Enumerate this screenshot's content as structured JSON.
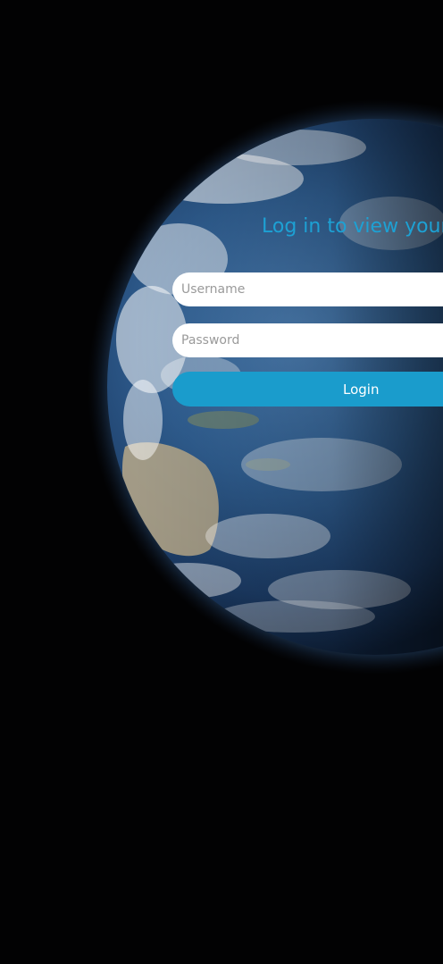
{
  "login": {
    "heading": "Log in to view your li",
    "username_placeholder": "Username",
    "username_value": "",
    "password_placeholder": "Password",
    "password_value": "",
    "button_label": "Login"
  },
  "background": {
    "image": "earth-from-space",
    "colors": {
      "space": "#020203",
      "accent": "#1da1d4",
      "button": "#1a9ccc"
    }
  }
}
